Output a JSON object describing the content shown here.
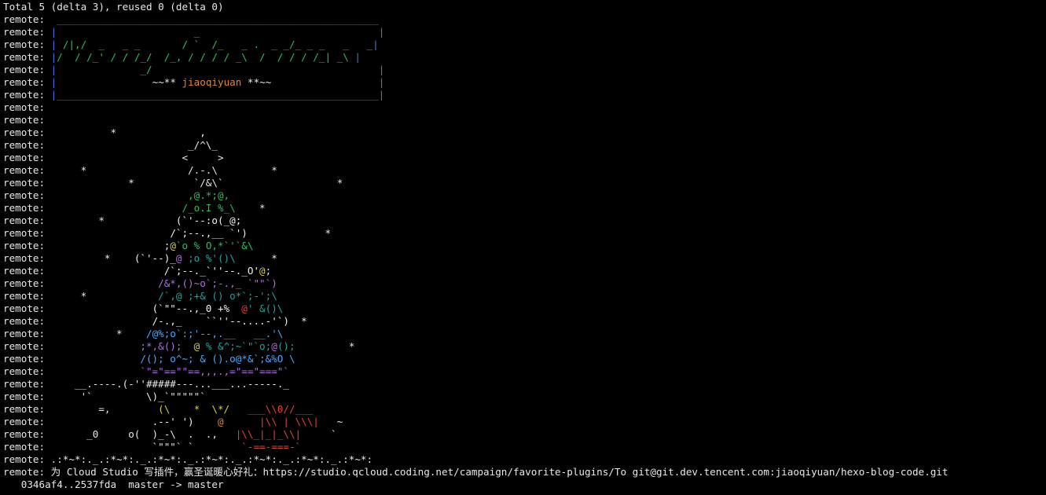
{
  "colors": {
    "background": "#000000",
    "default": "#e8e8e8",
    "blue": "#3f79d6",
    "green": "#27c25a",
    "orange": "#e0882b",
    "yellow": "#d9cf3f",
    "cyan": "#2aa7b4",
    "teal": "#20a4a0",
    "purple": "#b16fe0",
    "red": "#e0452b",
    "lightblue": "#4aa8ff",
    "white": "#f2f2f2",
    "gray": "#9a9a9a"
  },
  "terminal": {
    "lines": [
      [
        {
          "t": "Total 5 (delta 3), reused 0 (delta 0)",
          "c": "default"
        }
      ],
      [
        {
          "t": "remote: ",
          "c": "default"
        },
        {
          "t": " ______________________________________________________",
          "c": "blue"
        }
      ],
      [
        {
          "t": "remote: ",
          "c": "default"
        },
        {
          "t": "|",
          "c": "blue"
        },
        {
          "t": "                       _                              ",
          "c": "green"
        },
        {
          "t": "|",
          "c": "blue"
        }
      ],
      [
        {
          "t": "remote: ",
          "c": "default"
        },
        {
          "t": "|",
          "c": "blue"
        },
        {
          "t": " /|,/  _   _ _       / `  /_   _ .  _ _/_ _ _   _   _",
          "c": "green"
        },
        {
          "t": "|",
          "c": "blue"
        }
      ],
      [
        {
          "t": "remote: ",
          "c": "default"
        },
        {
          "t": "|",
          "c": "blue"
        },
        {
          "t": "/  / /_' / / /_/  /_, / / / / _\\  /  / / / /_| _\\ ",
          "c": "green"
        },
        {
          "t": "|",
          "c": "blue"
        }
      ],
      [
        {
          "t": "remote: ",
          "c": "default"
        },
        {
          "t": "|",
          "c": "blue"
        },
        {
          "t": "              _/                                      ",
          "c": "green"
        },
        {
          "t": "|",
          "c": "blue"
        }
      ],
      [
        {
          "t": "remote: ",
          "c": "default"
        },
        {
          "t": "|",
          "c": "blue"
        },
        {
          "t": "                ~~** ",
          "c": "default"
        },
        {
          "t": "jiaoqiyuan",
          "c": "orange"
        },
        {
          "t": " **~~                  ",
          "c": "default"
        },
        {
          "t": "|",
          "c": "blue"
        }
      ],
      [
        {
          "t": "remote: ",
          "c": "default"
        },
        {
          "t": "|______________________________________________________|",
          "c": "blue"
        }
      ],
      [
        {
          "t": "remote:",
          "c": "default"
        }
      ],
      [
        {
          "t": "remote:",
          "c": "default"
        }
      ],
      [
        {
          "t": "remote:           *              ,",
          "c": "default"
        }
      ],
      [
        {
          "t": "remote:                        _/^\\_",
          "c": "default"
        }
      ],
      [
        {
          "t": "remote:                       <     >",
          "c": "default"
        }
      ],
      [
        {
          "t": "remote:      *                 /.-.\\         *",
          "c": "default"
        }
      ],
      [
        {
          "t": "remote:              *          `/&\\`                   *",
          "c": "default"
        }
      ],
      [
        {
          "t": "remote:                        ",
          "c": "default"
        },
        {
          "t": ",@.*;@,",
          "c": "green"
        }
      ],
      [
        {
          "t": "remote:                       ",
          "c": "default"
        },
        {
          "t": "/_o.I %_\\",
          "c": "green"
        },
        {
          "t": "    *",
          "c": "default"
        }
      ],
      [
        {
          "t": "remote:         *            ",
          "c": "default"
        },
        {
          "t": "(`'--:o(_@;",
          "c": "white"
        }
      ],
      [
        {
          "t": "remote:                     ",
          "c": "default"
        },
        {
          "t": "/`;--.,__ `')",
          "c": "white"
        },
        {
          "t": "             *",
          "c": "default"
        }
      ],
      [
        {
          "t": "remote:                    ",
          "c": "default"
        },
        {
          "t": ";",
          "c": "default"
        },
        {
          "t": "@",
          "c": "yellow"
        },
        {
          "t": "`o % O,*`'`&\\",
          "c": "green"
        }
      ],
      [
        {
          "t": "remote:          *    ",
          "c": "default"
        },
        {
          "t": "(`'--)_",
          "c": "white"
        },
        {
          "t": "@",
          "c": "purple"
        },
        {
          "t": " ;o %'()\\",
          "c": "teal"
        },
        {
          "t": "      *",
          "c": "default"
        }
      ],
      [
        {
          "t": "remote:                    ",
          "c": "default"
        },
        {
          "t": "/`;--._`''--._O'",
          "c": "white"
        },
        {
          "t": "@",
          "c": "yellow"
        },
        {
          "t": ";",
          "c": "default"
        }
      ],
      [
        {
          "t": "remote:                   ",
          "c": "default"
        },
        {
          "t": "/&*,()~o`;-.,_ `\"\"`)",
          "c": "purple"
        }
      ],
      [
        {
          "t": "remote:      *            ",
          "c": "default"
        },
        {
          "t": "/`,@ ;+& () o*`;-';\\",
          "c": "teal"
        }
      ],
      [
        {
          "t": "remote:                  ",
          "c": "default"
        },
        {
          "t": "(`\"\"--.,_0 +% ",
          "c": "white"
        },
        {
          "t": " @",
          "c": "red"
        },
        {
          "t": "' &()\\",
          "c": "teal"
        }
      ],
      [
        {
          "t": "remote:                  ",
          "c": "default"
        },
        {
          "t": "/-.,_    ``''--....-'`)",
          "c": "white"
        },
        {
          "t": "  *",
          "c": "default"
        }
      ],
      [
        {
          "t": "remote:            *    ",
          "c": "default"
        },
        {
          "t": "/@%;o`:;'--,.__   __.'\\",
          "c": "lightblue"
        }
      ],
      [
        {
          "t": "remote:                ",
          "c": "default"
        },
        {
          "t": ";*,&();  ",
          "c": "purple"
        },
        {
          "t": "@",
          "c": "yellow"
        },
        {
          "t": " % &^;~`\"`o;",
          "c": "teal"
        },
        {
          "t": "@",
          "c": "purple"
        },
        {
          "t": "();",
          "c": "teal"
        },
        {
          "t": "         *",
          "c": "default"
        }
      ],
      [
        {
          "t": "remote:                ",
          "c": "default"
        },
        {
          "t": "/(); o^~; & ().o@*&`;&%O \\",
          "c": "lightblue"
        }
      ],
      [
        {
          "t": "remote:                ",
          "c": "default"
        },
        {
          "t": "`\"=\"==\"\"==,,,.,=\"==\"===\"`",
          "c": "purple"
        }
      ],
      [
        {
          "t": "remote:     __.----.(-''#####---...___...-----._",
          "c": "default"
        }
      ],
      [
        {
          "t": "remote:      '`         \\)_`\"\"\"\"\"`",
          "c": "default"
        }
      ],
      [
        {
          "t": "remote:         =,        ",
          "c": "default"
        },
        {
          "t": "(\\    *  \\*/  ",
          "c": "yellow"
        },
        {
          "t": " ___\\\\0//___",
          "c": "red"
        }
      ],
      [
        {
          "t": "remote:                  ",
          "c": "default"
        },
        {
          "t": ".--' ')",
          "c": "white"
        },
        {
          "t": "    @      ",
          "c": "orange"
        },
        {
          "t": "|\\\\ | \\\\\\|",
          "c": "red"
        },
        {
          "t": "   ~",
          "c": "default"
        }
      ],
      [
        {
          "t": "remote:       _0     o(  )_-\\  .  .,   ",
          "c": "default"
        },
        {
          "t": "|\\\\_|_|_\\\\|",
          "c": "red"
        },
        {
          "t": "     `",
          "c": "default"
        }
      ],
      [
        {
          "t": "remote:                  `\"\"\"` `        ",
          "c": "default"
        },
        {
          "t": "`-==-===-`",
          "c": "red"
        }
      ],
      [
        {
          "t": "remote: .:*~*:._.:*~*:._.:*~*:._.:*~*:._.:*~*:._.:*~*:._.:*~*:",
          "c": "default"
        }
      ],
      [
        {
          "t": "remote: 为 Cloud Studio 写插件，赢圣诞暖心好礼：https://studio.qcloud.coding.net/campaign/favorite-plugins/To git@git.dev.tencent.com:jiaoqiyuan/hexo-blog-code.git",
          "c": "default"
        }
      ],
      [
        {
          "t": "   0346af4..2537fda  master -> master",
          "c": "default"
        }
      ]
    ]
  }
}
